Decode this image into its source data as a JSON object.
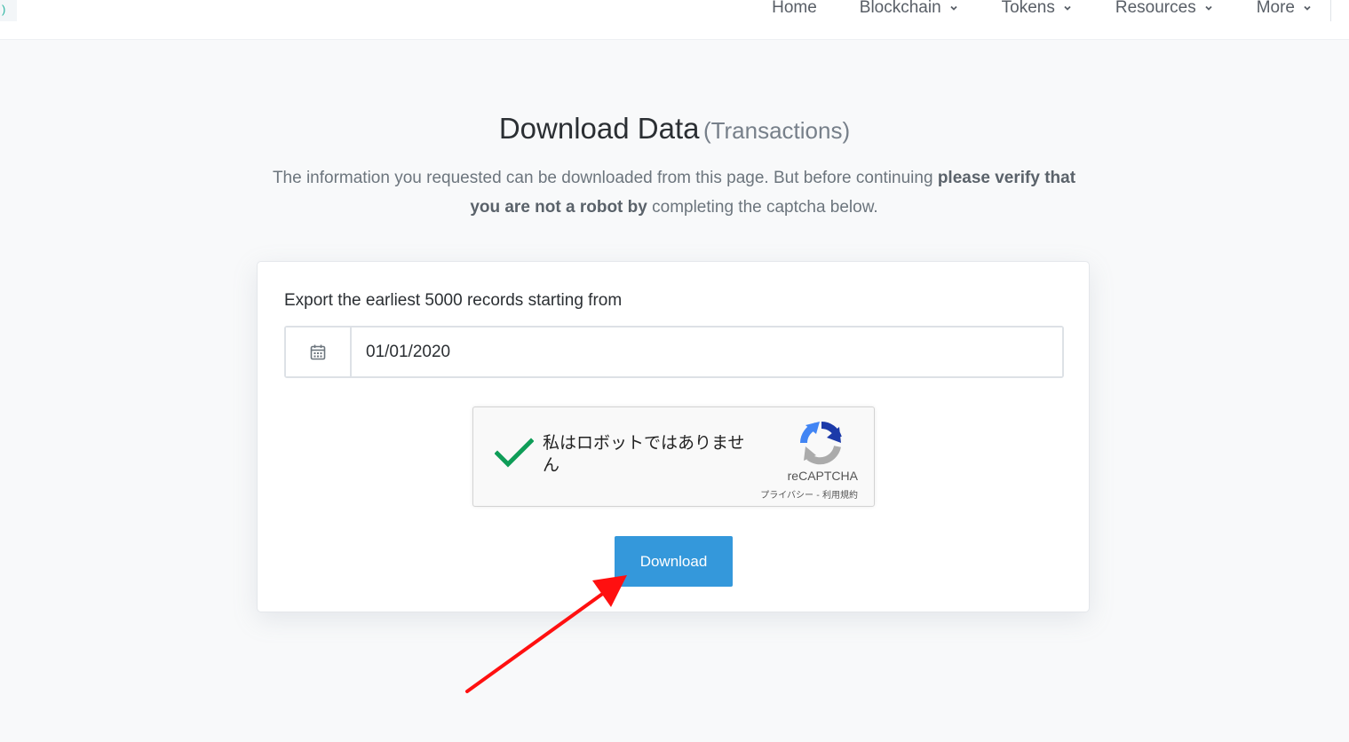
{
  "header": {
    "logo_fragment": ")",
    "nav": [
      {
        "label": "Home",
        "dropdown": false
      },
      {
        "label": "Blockchain",
        "dropdown": true
      },
      {
        "label": "Tokens",
        "dropdown": true
      },
      {
        "label": "Resources",
        "dropdown": true
      },
      {
        "label": "More",
        "dropdown": true
      }
    ]
  },
  "page": {
    "title": "Download Data",
    "subtitle": "(Transactions)",
    "description_part1": "The information you requested can be downloaded from this page. But before continuing ",
    "description_bold": "please verify that you are not a robot by",
    "description_part2": " completing the captcha below."
  },
  "form": {
    "export_label": "Export the earliest 5000 records starting from",
    "date_value": "01/01/2020",
    "calendar_icon": "calendar-icon",
    "download_label": "Download"
  },
  "captcha": {
    "text": "私はロボットではありません",
    "brand": "reCAPTCHA",
    "links": "プライバシー - 利用規約",
    "checked": true
  },
  "colors": {
    "primary": "#3498db",
    "check": "#0f9d58",
    "arrow": "#ff1010"
  }
}
